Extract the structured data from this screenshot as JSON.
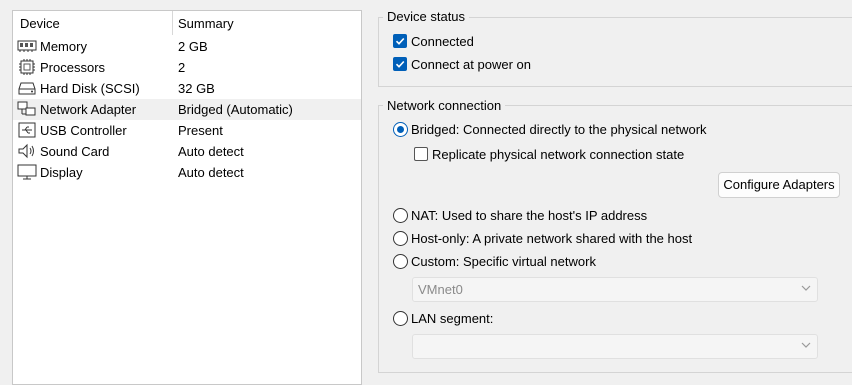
{
  "device_list": {
    "columns": {
      "device": "Device",
      "summary": "Summary"
    },
    "rows": [
      {
        "name": "Memory",
        "summary": "2 GB",
        "icon": "memory-icon"
      },
      {
        "name": "Processors",
        "summary": "2",
        "icon": "processor-icon"
      },
      {
        "name": "Hard Disk (SCSI)",
        "summary": "32 GB",
        "icon": "hard-disk-icon"
      },
      {
        "name": "Network Adapter",
        "summary": "Bridged (Automatic)",
        "icon": "network-adapter-icon",
        "selected": true
      },
      {
        "name": "USB Controller",
        "summary": "Present",
        "icon": "usb-icon"
      },
      {
        "name": "Sound Card",
        "summary": "Auto detect",
        "icon": "speaker-icon"
      },
      {
        "name": "Display",
        "summary": "Auto detect",
        "icon": "monitor-icon"
      }
    ]
  },
  "device_status": {
    "title": "Device status",
    "connected": {
      "label": "Connected",
      "checked": true
    },
    "connect_at_power_on": {
      "label": "Connect at power on",
      "checked": true
    }
  },
  "network_connection": {
    "title": "Network connection",
    "bridged": {
      "label": "Bridged: Connected directly to the physical network",
      "selected": true
    },
    "replicate": {
      "label": "Replicate physical network connection state",
      "checked": false
    },
    "configure_button": "Configure Adapters",
    "nat": {
      "label": "NAT: Used to share the host's IP address",
      "selected": false
    },
    "host_only": {
      "label": "Host-only: A private network shared with the host",
      "selected": false
    },
    "custom": {
      "label": "Custom: Specific virtual network",
      "selected": false
    },
    "custom_network": {
      "value": "VMnet0",
      "disabled": true
    },
    "lan_segment": {
      "label": "LAN segment:",
      "selected": false
    },
    "lan_segment_select": {
      "value": "",
      "disabled": true
    }
  },
  "colors": {
    "accent": "#005fb8",
    "selected_row": "#f0f0f0",
    "window_bg": "#f0f0f0"
  }
}
